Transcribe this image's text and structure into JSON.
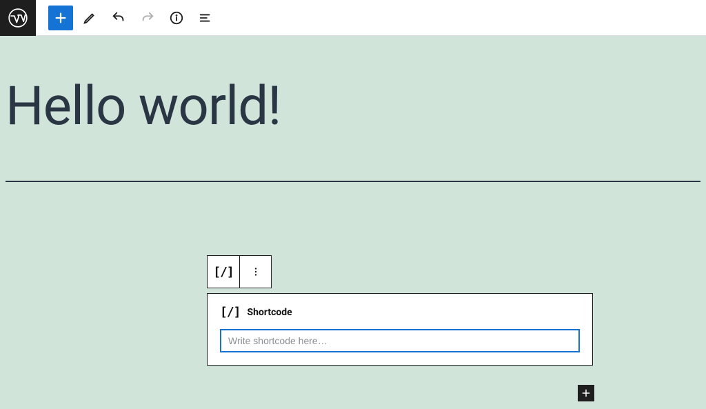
{
  "toolbar": {
    "icons": {
      "wp": "wordpress-icon",
      "add": "plus-icon",
      "edit": "pencil-icon",
      "undo": "undo-icon",
      "redo": "redo-icon",
      "info": "info-icon",
      "outline": "outline-icon"
    }
  },
  "post": {
    "title": "Hello world!"
  },
  "block": {
    "type_icon": "shortcode-icon",
    "type_label": "Shortcode",
    "placeholder": "Write shortcode here…",
    "value": ""
  },
  "colors": {
    "accent": "#1573d6",
    "canvas_bg": "#d0e4da",
    "title_fg": "#2b3644",
    "ink": "#1e1e1e"
  }
}
